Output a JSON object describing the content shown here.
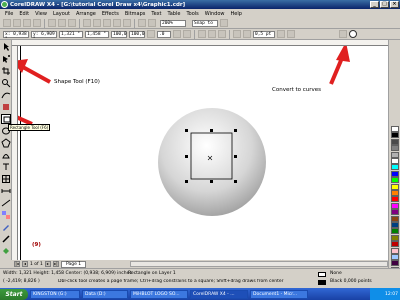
{
  "window": {
    "title": "CorelDRAW X4 - [G:\\tutorial Corel Draw x4\\Graphic1.cdr]",
    "controls": [
      "_",
      "□",
      "×"
    ]
  },
  "menu": [
    "File",
    "Edit",
    "View",
    "Layout",
    "Arrange",
    "Effects",
    "Bitmaps",
    "Text",
    "Table",
    "Tools",
    "Window",
    "Help"
  ],
  "standard_toolbar": {
    "zoom": "200%",
    "snap_to": "Snap to"
  },
  "property_bar": {
    "x": "x: 0,938 \"",
    "y": "y: 6,909 \"",
    "width": "1,321 \"",
    "height": "1,458 \"",
    "scale_w": "100,0",
    "scale_h": "100,0",
    "angle": ".0",
    "outline_width": "0,5 pt"
  },
  "tooltip": "Rectangle Tool (F6)",
  "annotations": {
    "shape_tool": "Shape Tool (F10)",
    "convert": "Convert to curves",
    "step": "(9)"
  },
  "page_tabs": {
    "page_info": "1 of 1",
    "tab": "Page 1"
  },
  "status": {
    "line1": "Width: 1,321 Height: 1,458 Center: (0,938; 6,909)  inches",
    "line1_right": "Rectangle on Layer 1",
    "line2": "( -2,419; 8,826 )",
    "line2_mid": "Dbl-click tool creates a page frame; Ctrl+drag constrains to a square; Shift+drag draws from center",
    "fill": "None",
    "outline": "Black  0,000 points"
  },
  "taskbar": {
    "start": "Start",
    "tasks": [
      "KINGSTON (G:)",
      "Data (D:)",
      "MiHBLOT LOGO SO...",
      "CorelDRAW X4 - ...",
      "Document1 - Micr..."
    ],
    "clock": "12:07"
  },
  "colors": {
    "accent_arrow": "#e02020",
    "titlebar": "#0a246a"
  },
  "palette": [
    "#ffffff",
    "#000000",
    "#4a4a4a",
    "#808080",
    "#b0b0b0",
    "#ffffff",
    "#00ffff",
    "#0000ff",
    "#00ff00",
    "#ffff00",
    "#ff8000",
    "#ff0000",
    "#ff00ff",
    "#800080",
    "#8b4513",
    "#004080",
    "#008000",
    "#808000",
    "#c00000",
    "#ffc0cb",
    "#a0c8ff",
    "#400040",
    "#60a060",
    "#d0a060"
  ]
}
